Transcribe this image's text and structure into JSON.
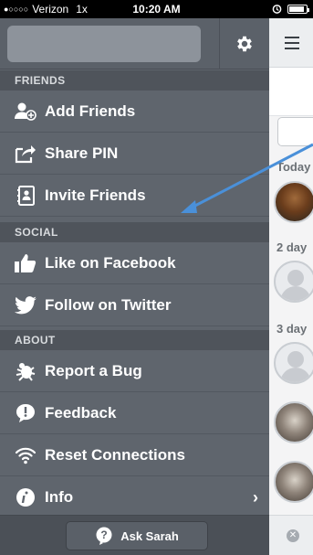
{
  "status_bar": {
    "carrier": "Verizon",
    "network": "1x",
    "time": "10:20 AM",
    "signal_dots": "●○○○○"
  },
  "drawer": {
    "groups": [
      {
        "header": "FRIENDS",
        "items": [
          {
            "label": "Add Friends",
            "icon": "add-friend-icon"
          },
          {
            "label": "Share PIN",
            "icon": "share-icon"
          },
          {
            "label": "Invite Friends",
            "icon": "address-book-icon"
          }
        ]
      },
      {
        "header": "SOCIAL",
        "items": [
          {
            "label": "Like on Facebook",
            "icon": "thumbs-up-icon"
          },
          {
            "label": "Follow on Twitter",
            "icon": "twitter-bird-icon"
          }
        ]
      },
      {
        "header": "ABOUT",
        "items": [
          {
            "label": "Report a Bug",
            "icon": "bug-icon"
          },
          {
            "label": "Feedback",
            "icon": "speech-bubble-icon"
          },
          {
            "label": "Reset Connections",
            "icon": "wifi-icon"
          },
          {
            "label": "Info",
            "icon": "info-icon"
          }
        ]
      }
    ],
    "footer": {
      "ask_label": "Ask Sarah"
    }
  },
  "main": {
    "sections": [
      "Today",
      "2 day",
      "3 day"
    ]
  },
  "colors": {
    "drawer_bg": "#5f656d",
    "group_header_bg": "#4f545b",
    "arrow": "#4a90d9"
  }
}
